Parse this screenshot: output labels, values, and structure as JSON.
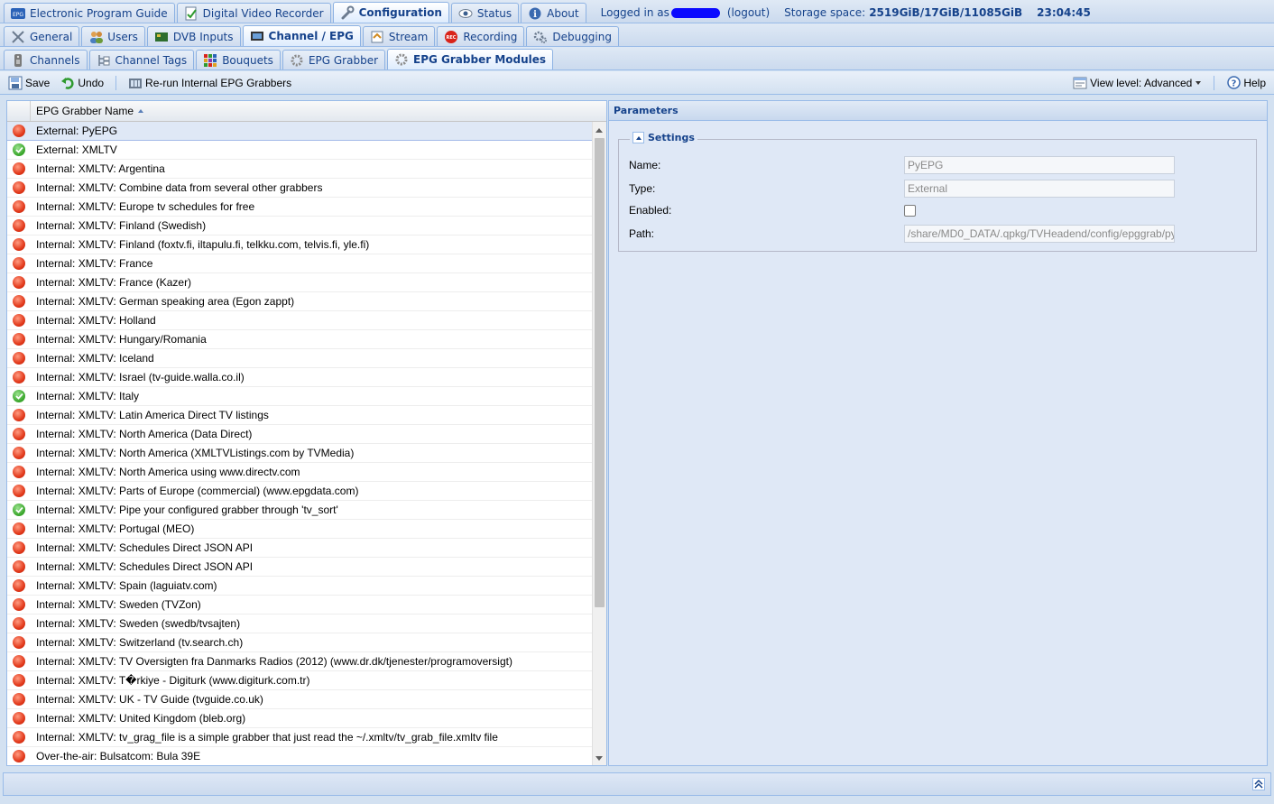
{
  "tabs_top": [
    {
      "label": "Electronic Program Guide",
      "icon": "epg-icon",
      "active": false
    },
    {
      "label": "Digital Video Recorder",
      "icon": "dvr-icon",
      "active": false
    },
    {
      "label": "Configuration",
      "icon": "wrench-icon",
      "active": true
    },
    {
      "label": "Status",
      "icon": "eye-icon",
      "active": false
    },
    {
      "label": "About",
      "icon": "info-icon",
      "active": false
    }
  ],
  "status": {
    "logged_in": "Logged in as",
    "logout": "(logout)",
    "storage_label": "Storage space:",
    "storage_value": "2519GiB/17GiB/11085GiB",
    "time": "23:04:45"
  },
  "tabs_second": [
    {
      "label": "General",
      "icon": "tools-icon",
      "active": false
    },
    {
      "label": "Users",
      "icon": "users-icon",
      "active": false
    },
    {
      "label": "DVB Inputs",
      "icon": "card-icon",
      "active": false
    },
    {
      "label": "Channel / EPG",
      "icon": "tv-icon",
      "active": true
    },
    {
      "label": "Stream",
      "icon": "stream-icon",
      "active": false
    },
    {
      "label": "Recording",
      "icon": "rec-icon",
      "active": false
    },
    {
      "label": "Debugging",
      "icon": "gears-icon",
      "active": false
    }
  ],
  "tabs_third": [
    {
      "label": "Channels",
      "icon": "remote-icon",
      "active": false
    },
    {
      "label": "Channel Tags",
      "icon": "tree-icon",
      "active": false
    },
    {
      "label": "Bouquets",
      "icon": "grid-icon",
      "active": false
    },
    {
      "label": "EPG Grabber",
      "icon": "grabber-icon",
      "active": false
    },
    {
      "label": "EPG Grabber Modules",
      "icon": "grabber-icon",
      "active": true
    }
  ],
  "toolbar": {
    "save": "Save",
    "undo": "Undo",
    "rerun": "Re-run Internal EPG Grabbers",
    "view_level": "View level: Advanced",
    "help": "Help"
  },
  "grid": {
    "column": "EPG Grabber Name",
    "rows": [
      {
        "name": "External: PyEPG",
        "enabled": false,
        "selected": true
      },
      {
        "name": "External: XMLTV",
        "enabled": true
      },
      {
        "name": "Internal: XMLTV: Argentina",
        "enabled": false
      },
      {
        "name": "Internal: XMLTV: Combine data from several other grabbers",
        "enabled": false
      },
      {
        "name": "Internal: XMLTV: Europe tv schedules for free",
        "enabled": false
      },
      {
        "name": "Internal: XMLTV: Finland (Swedish)",
        "enabled": false
      },
      {
        "name": "Internal: XMLTV: Finland (foxtv.fi, iltapulu.fi, telkku.com, telvis.fi, yle.fi)",
        "enabled": false
      },
      {
        "name": "Internal: XMLTV: France",
        "enabled": false
      },
      {
        "name": "Internal: XMLTV: France (Kazer)",
        "enabled": false
      },
      {
        "name": "Internal: XMLTV: German speaking area (Egon zappt)",
        "enabled": false
      },
      {
        "name": "Internal: XMLTV: Holland",
        "enabled": false
      },
      {
        "name": "Internal: XMLTV: Hungary/Romania",
        "enabled": false
      },
      {
        "name": "Internal: XMLTV: Iceland",
        "enabled": false
      },
      {
        "name": "Internal: XMLTV: Israel (tv-guide.walla.co.il)",
        "enabled": false
      },
      {
        "name": "Internal: XMLTV: Italy",
        "enabled": true
      },
      {
        "name": "Internal: XMLTV: Latin America Direct TV listings",
        "enabled": false
      },
      {
        "name": "Internal: XMLTV: North America (Data Direct)",
        "enabled": false
      },
      {
        "name": "Internal: XMLTV: North America (XMLTVListings.com by TVMedia)",
        "enabled": false
      },
      {
        "name": "Internal: XMLTV: North America using www.directv.com",
        "enabled": false
      },
      {
        "name": "Internal: XMLTV: Parts of Europe (commercial) (www.epgdata.com)",
        "enabled": false
      },
      {
        "name": "Internal: XMLTV: Pipe your configured grabber through 'tv_sort'",
        "enabled": true
      },
      {
        "name": "Internal: XMLTV: Portugal (MEO)",
        "enabled": false
      },
      {
        "name": "Internal: XMLTV: Schedules Direct JSON API",
        "enabled": false
      },
      {
        "name": "Internal: XMLTV: Schedules Direct JSON API",
        "enabled": false
      },
      {
        "name": "Internal: XMLTV: Spain (laguiatv.com)",
        "enabled": false
      },
      {
        "name": "Internal: XMLTV: Sweden (TVZon)",
        "enabled": false
      },
      {
        "name": "Internal: XMLTV: Sweden (swedb/tvsajten)",
        "enabled": false
      },
      {
        "name": "Internal: XMLTV: Switzerland (tv.search.ch)",
        "enabled": false
      },
      {
        "name": "Internal: XMLTV: TV Oversigten fra Danmarks Radios (2012) (www.dr.dk/tjenester/programoversigt)",
        "enabled": false
      },
      {
        "name": "Internal: XMLTV: T�rkiye - Digiturk (www.digiturk.com.tr)",
        "enabled": false
      },
      {
        "name": "Internal: XMLTV: UK - TV Guide (tvguide.co.uk)",
        "enabled": false
      },
      {
        "name": "Internal: XMLTV: United Kingdom (bleb.org)",
        "enabled": false
      },
      {
        "name": "Internal: XMLTV: tv_grag_file is a simple grabber that just read the ~/.xmltv/tv_grab_file.xmltv file",
        "enabled": false
      },
      {
        "name": "Over-the-air: Bulsatcom: Bula 39E",
        "enabled": false
      }
    ]
  },
  "params": {
    "title": "Parameters",
    "legend": "Settings",
    "name_label": "Name:",
    "name_value": "PyEPG",
    "type_label": "Type:",
    "type_value": "External",
    "enabled_label": "Enabled:",
    "path_label": "Path:",
    "path_value": "/share/MD0_DATA/.qpkg/TVHeadend/config/epggrab/py"
  },
  "colors": {
    "accent": "#15428b",
    "panel_bg": "#dfe8f6",
    "border": "#99bbe8",
    "disabled_dot": "#e2391b",
    "enabled_dot": "#3aa62c"
  }
}
